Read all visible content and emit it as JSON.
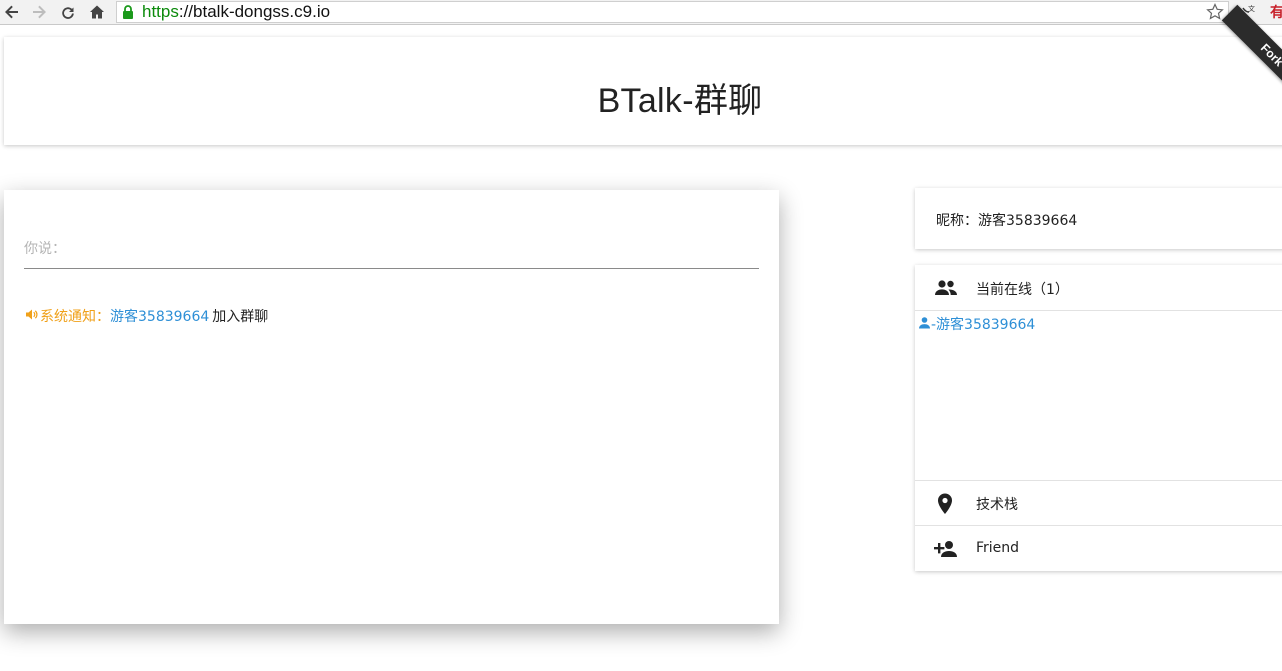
{
  "browser": {
    "url_scheme": "https",
    "url_rest": "://btalk-dongss.c9.io",
    "icons": [
      "back-icon",
      "forward-icon",
      "reload-icon",
      "home-icon",
      "lock-icon",
      "star-icon",
      "translate-extension-icon"
    ]
  },
  "header": {
    "title": "BTalk-群聊",
    "fork_ribbon": "Fork"
  },
  "chat": {
    "input_placeholder": "你说：",
    "messages": [
      {
        "type": "system",
        "icon": "speaker-icon",
        "label": "系统通知：",
        "user": "游客35839664",
        "text": "加入群聊"
      }
    ]
  },
  "sidebar": {
    "nickname": "昵称：游客35839664",
    "online_label": "当前在线（1）",
    "online_users": [
      "-游客35839664"
    ],
    "tech_stack_label": "技术栈",
    "friend_label": "Friend"
  },
  "colors": {
    "system_notice": "#f0a11a",
    "username_link": "#2e8fd6",
    "url_scheme": "#0b8a0b"
  }
}
